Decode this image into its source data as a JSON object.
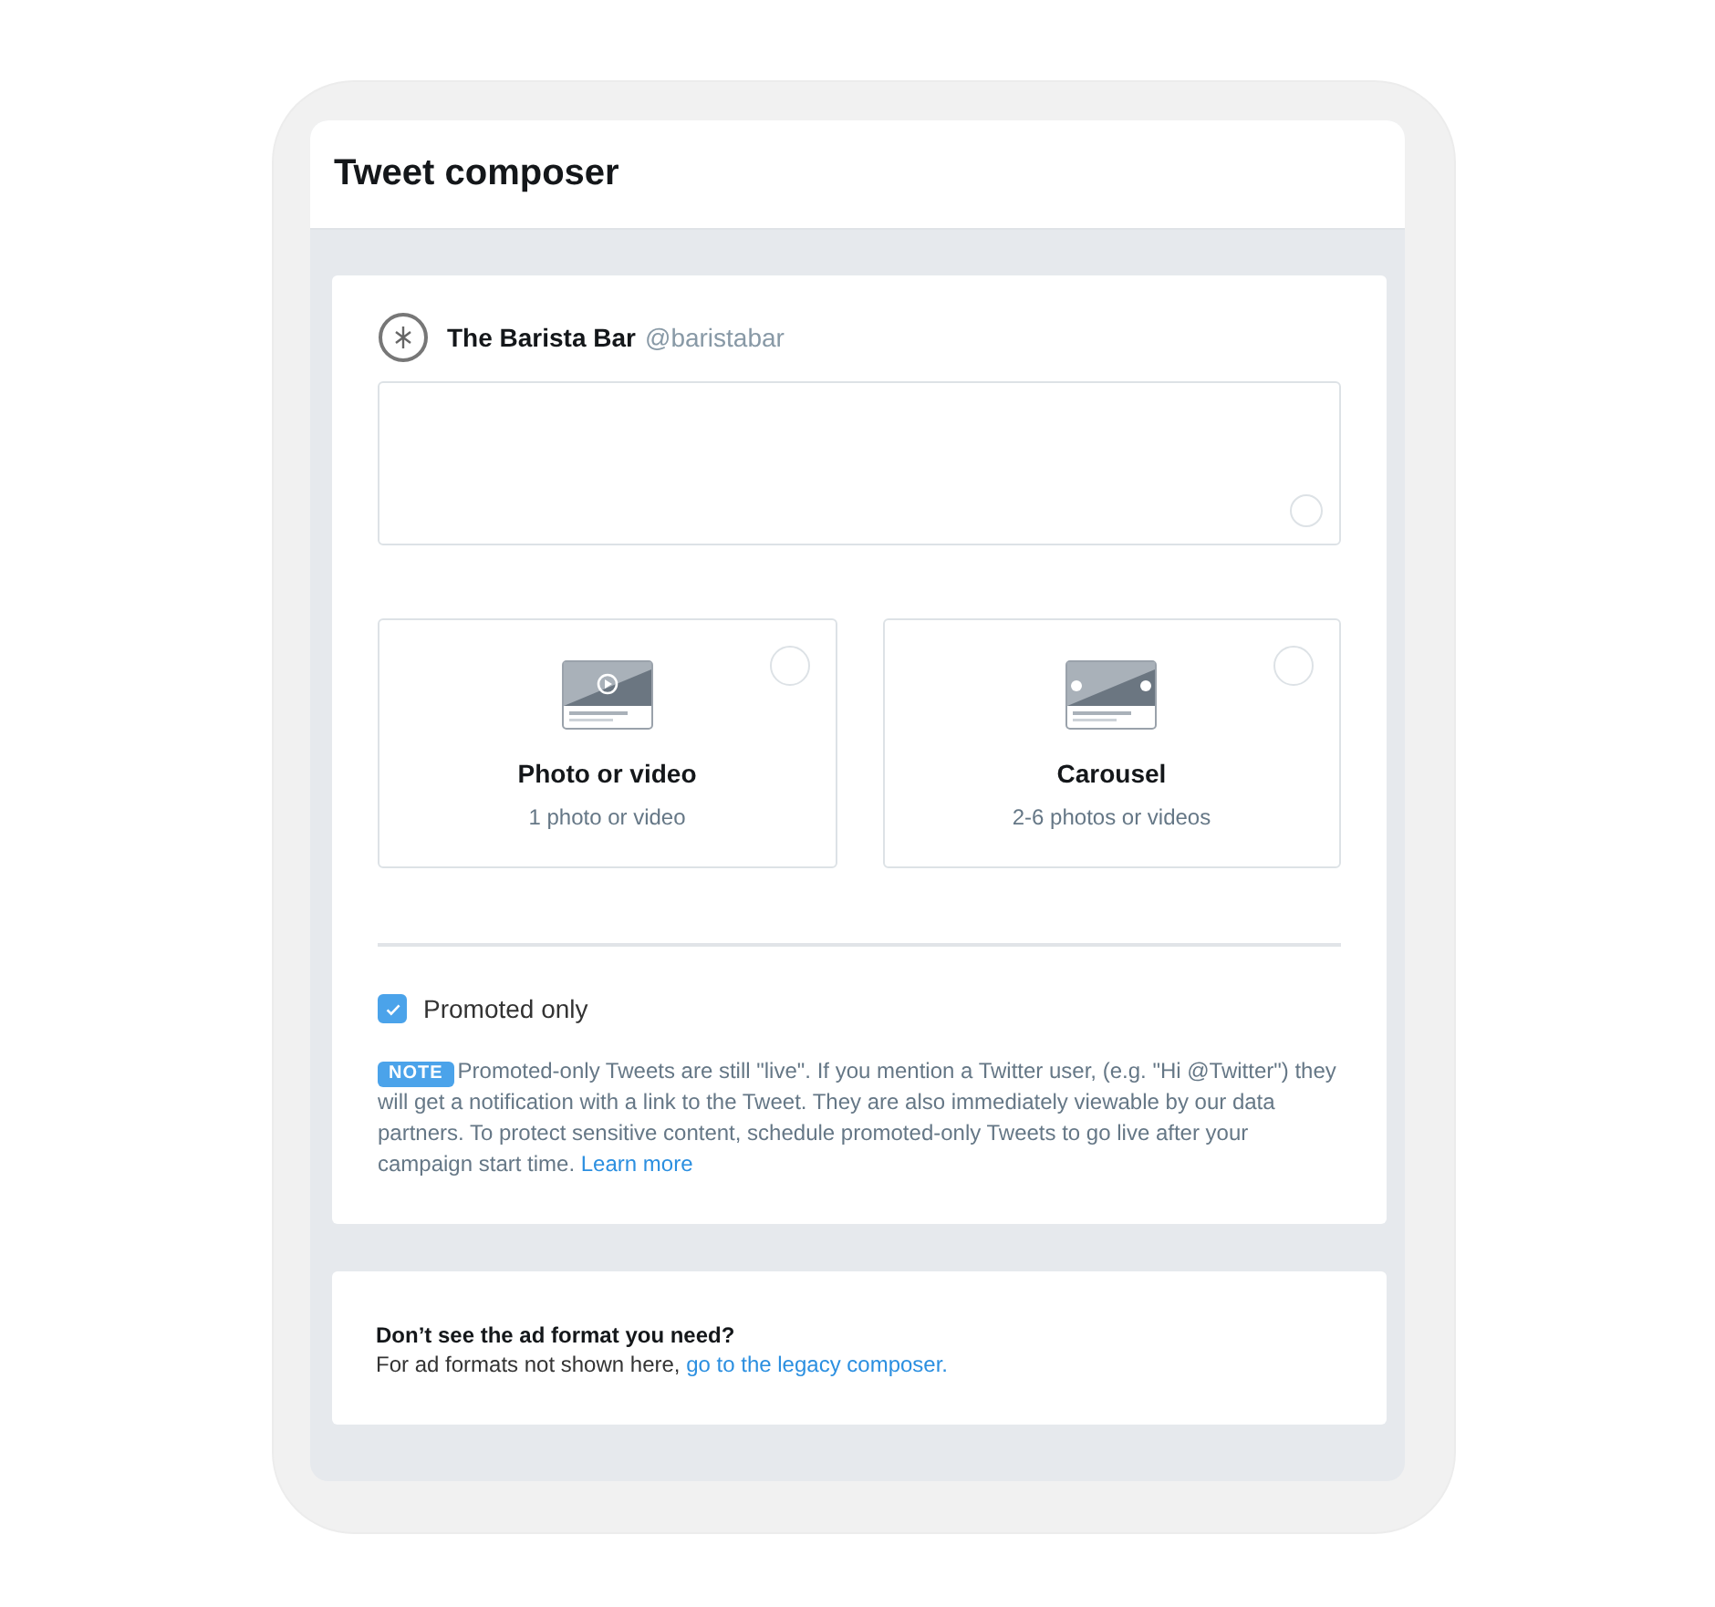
{
  "window": {
    "title": "Tweet composer"
  },
  "account": {
    "name": "The Barista Bar",
    "handle": "@baristabar"
  },
  "media_options": [
    {
      "kind": "video",
      "title": "Photo or video",
      "subtitle": "1 photo or video",
      "selected": false
    },
    {
      "kind": "carousel",
      "title": "Carousel",
      "subtitle": "2-6 photos or videos",
      "selected": false
    }
  ],
  "promoted_only": {
    "label": "Promoted only",
    "checked": true
  },
  "note": {
    "badge": "NOTE",
    "text": "Promoted-only Tweets are still \"live\". If you mention a Twitter user, (e.g. \"Hi @Twitter\") they will get a notification with a link to the Tweet. They are also immediately viewable by our data partners. To protect sensitive content, schedule promoted-only Tweets to go live after your campaign start time.",
    "link": "Learn more"
  },
  "footer": {
    "heading": "Don’t see the ad format you need?",
    "text": "For ad formats not shown here,",
    "link": "go to the legacy composer."
  }
}
